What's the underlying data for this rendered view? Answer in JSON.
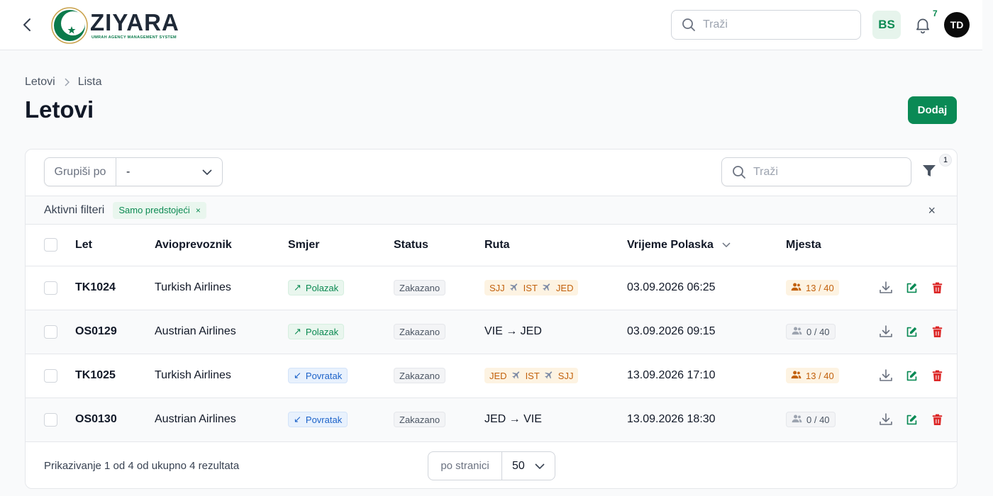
{
  "brand": {
    "name": "ZIYARA",
    "tagline": "UMRAH AGENCY MANAGEMENT SYSTEM",
    "accent": "#0a8a55"
  },
  "topbar": {
    "search_placeholder": "Traži",
    "language": "BS",
    "notifications_count": "7",
    "user_initials": "TD"
  },
  "breadcrumb": [
    "Letovi",
    "Lista"
  ],
  "page": {
    "title": "Letovi",
    "add_label": "Dodaj"
  },
  "toolbar": {
    "group_label": "Grupiši po",
    "group_value": "-",
    "search_placeholder": "Traži",
    "filter_count": "1"
  },
  "filters": {
    "label": "Aktivni filteri",
    "active": "Samo predstojeći",
    "remove_icon": "×",
    "clear_icon": "×"
  },
  "table": {
    "columns": [
      "Let",
      "Avioprevoznik",
      "Smjer",
      "Status",
      "Ruta",
      "Vrijeme Polaska",
      "Mjesta"
    ],
    "rows": [
      {
        "let": "TK1024",
        "airline": "Turkish Airlines",
        "direction": "Polazak",
        "direction_icon": "↗",
        "status": "Zakazano",
        "route_type": "stops",
        "route": [
          "SJJ",
          "IST",
          "JED"
        ],
        "route_text": "",
        "time": "03.09.2026 06:25",
        "seats": "13 / 40",
        "seats_style": "warm"
      },
      {
        "let": "OS0129",
        "airline": "Austrian Airlines",
        "direction": "Polazak",
        "direction_icon": "↗",
        "status": "Zakazano",
        "route_type": "direct",
        "route": [],
        "route_text": "VIE → JED",
        "time": "03.09.2026 09:15",
        "seats": "0 / 40",
        "seats_style": "grey"
      },
      {
        "let": "TK1025",
        "airline": "Turkish Airlines",
        "direction": "Povratak",
        "direction_icon": "↙",
        "status": "Zakazano",
        "route_type": "stops",
        "route": [
          "JED",
          "IST",
          "SJJ"
        ],
        "route_text": "",
        "time": "13.09.2026 17:10",
        "seats": "13 / 40",
        "seats_style": "warm"
      },
      {
        "let": "OS0130",
        "airline": "Austrian Airlines",
        "direction": "Povratak",
        "direction_icon": "↙",
        "status": "Zakazano",
        "route_type": "direct",
        "route": [],
        "route_text": "JED → VIE",
        "time": "13.09.2026 18:30",
        "seats": "0 / 40",
        "seats_style": "grey"
      }
    ]
  },
  "footer": {
    "results_text": "Prikazivanje 1 od 4 od ukupno 4 rezultata",
    "per_page_label": "po stranici",
    "per_page_value": "50"
  }
}
